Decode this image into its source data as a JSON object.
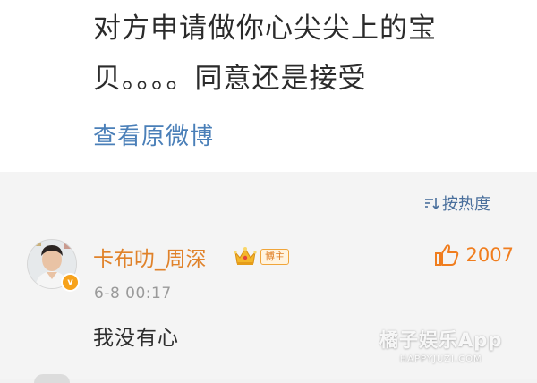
{
  "post": {
    "text_line1": "对方申请做你心尖尖上的宝",
    "text_line2": "贝。。。。同意还是接受",
    "view_original": "查看原微博"
  },
  "comments_header": {
    "sort_label": "按热度",
    "sort_icon": "sort-icon"
  },
  "comment": {
    "avatar_icon": "avatar",
    "verified_icon": "verified-v-icon",
    "verified_text": "v",
    "username": "卡布叻_周深",
    "crown_icon": "crown-icon",
    "role_badge": "博主",
    "like_icon": "thumbs-up-icon",
    "like_count": "2007",
    "time": "6-8 00:17",
    "text": "我没有心"
  },
  "watermark": {
    "brand": "橘子娱乐App",
    "domain": "HAPPYJUZI.COM"
  },
  "colors": {
    "link_blue": "#4a7fb8",
    "username_orange": "#e0822a",
    "like_orange": "#f07d1e",
    "badge_orange": "#f7a21b"
  }
}
